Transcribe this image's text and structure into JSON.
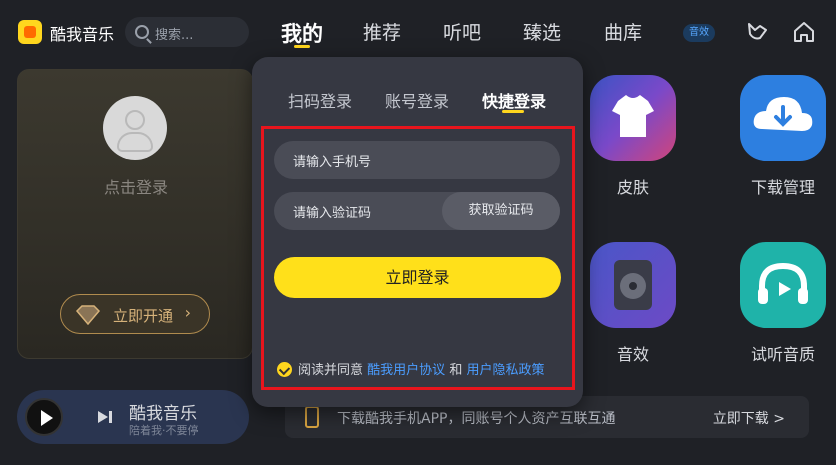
{
  "header": {
    "app_name": "酷我音乐",
    "search_placeholder": "搜索...",
    "nav": [
      "我的",
      "推荐",
      "听吧",
      "臻选",
      "曲库"
    ],
    "badge": "音效"
  },
  "user_card": {
    "login_hint": "点击登录",
    "vip_button": "立即开通"
  },
  "player": {
    "title": "酷我音乐",
    "subtitle": "陪着我·不要停"
  },
  "tiles": [
    "皮肤",
    "下载管理",
    "音效",
    "试听音质"
  ],
  "banner": {
    "text": "下载酷我手机APP，同账号个人资产互联互通",
    "link": "立即下载 >"
  },
  "login_modal": {
    "tabs": [
      "扫码登录",
      "账号登录",
      "快捷登录"
    ],
    "active_tab": "快捷登录",
    "phone_placeholder": "请输入手机号",
    "code_placeholder": "请输入验证码",
    "get_code_label": "获取验证码",
    "submit_label": "立即登录",
    "agree_prefix": "阅读并同意",
    "agree_link1": "酷我用户协议",
    "agree_and": "和",
    "agree_link2": "用户隐私政策"
  },
  "colors": {
    "accent": "#ffe01a",
    "link": "#4b9dff",
    "highlight_frame": "#e8151d"
  }
}
